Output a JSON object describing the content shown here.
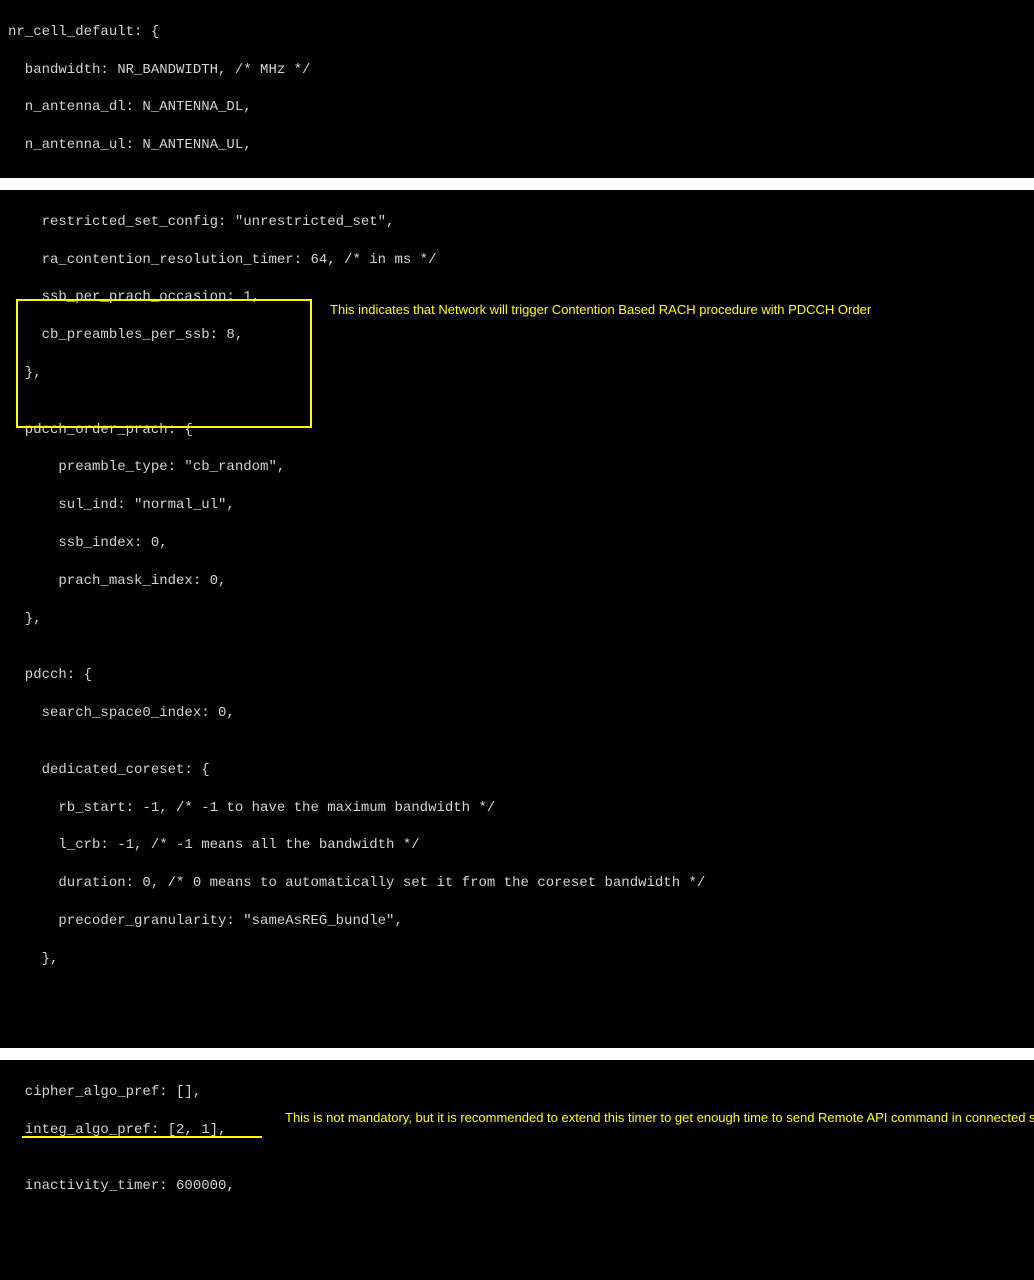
{
  "block1": {
    "l1": "nr_cell_default: {",
    "l2": "  bandwidth: NR_BANDWIDTH, /* MHz */",
    "l3": "  n_antenna_dl: N_ANTENNA_DL,",
    "l4": "  n_antenna_ul: N_ANTENNA_UL,"
  },
  "block2": {
    "l1": "    restricted_set_config: \"unrestricted_set\",",
    "l2": "    ra_contention_resolution_timer: 64, /* in ms */",
    "l3": "    ssb_per_prach_occasion: 1,",
    "l4": "    cb_preambles_per_ssb: 8,",
    "l5": "  },",
    "l6": "",
    "l7": "  pdcch_order_prach: {",
    "l8": "      preamble_type: \"cb_random\",",
    "l9": "      sul_ind: \"normal_ul\",",
    "l10": "      ssb_index: 0,",
    "l11": "      prach_mask_index: 0,",
    "l12": "  },",
    "l13": "",
    "l14": "  pdcch: {",
    "l15": "    search_space0_index: 0,",
    "l16": "",
    "l17": "    dedicated_coreset: {",
    "l18": "      rb_start: -1, /* -1 to have the maximum bandwidth */",
    "l19": "      l_crb: -1, /* -1 means all the bandwidth */",
    "l20": "      duration: 0, /* 0 means to automatically set it from the coreset bandwidth */",
    "l21": "      precoder_granularity: \"sameAsREG_bundle\",",
    "l22": "    },"
  },
  "block3": {
    "l1": "  cipher_algo_pref: [],",
    "l2": "  integ_algo_pref: [2, 1],",
    "l3": "",
    "l4": "  inactivity_timer: 600000,"
  },
  "annotations": {
    "a1": "This indicates that Network will trigger Contention Based RACH procedure with PDCCH Order",
    "a2": "This is not mandatory, but it is recommended to extend this timer to get enough time to send Remote API command in connected states"
  }
}
